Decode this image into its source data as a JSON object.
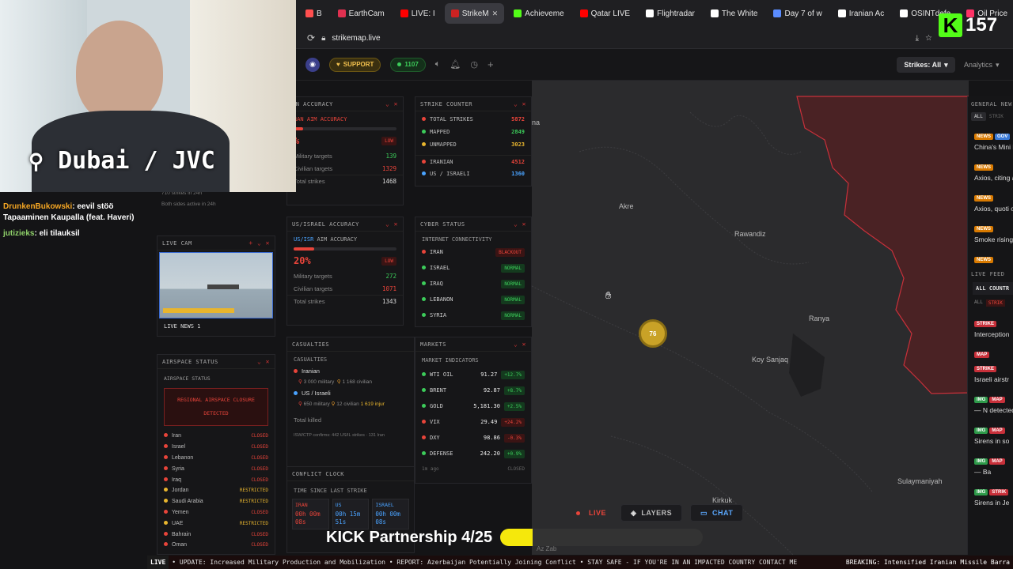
{
  "browser": {
    "tabs": [
      {
        "label": "B",
        "color": "#ff4f4f"
      },
      {
        "label": "EarthCam",
        "color": "#e03050"
      },
      {
        "label": "LIVE: I",
        "color": "#ff0000"
      },
      {
        "label": "StrikeM",
        "color": "#cc2222",
        "active": true
      },
      {
        "label": "Achieveme",
        "color": "#53fc18"
      },
      {
        "label": "Qatar LIVE",
        "color": "#ff0000"
      },
      {
        "label": "Flightradar",
        "color": "#ffffff"
      },
      {
        "label": "The White",
        "color": "#ffffff"
      },
      {
        "label": "Day 7 of w",
        "color": "#5a8cff"
      },
      {
        "label": "Iranian Ac",
        "color": "#ffffff"
      },
      {
        "label": "OSINTdefe",
        "color": "#ffffff"
      },
      {
        "label": "Oil Price",
        "color": "#ff3366"
      }
    ],
    "url": "strikemap.live"
  },
  "stream": {
    "location_overlay": "Dubai / JVC",
    "viewer_count": "157",
    "partnership_text": "KICK Partnership 4/25",
    "partnership_progress": 0.16,
    "chat": [
      {
        "user": "DrunkenBukowski",
        "user_color": "#f5a623",
        "message": "eevil stöö Tapaaminen Kaupalla (feat. Haveri)"
      },
      {
        "user": "jutizieks",
        "user_color": "#8fd16a",
        "message": "eli tilauksil"
      }
    ]
  },
  "toolbar": {
    "support_label": "SUPPORT",
    "online_count": "1107",
    "strikes_filter": "Strikes: All",
    "analytics_label": "Analytics"
  },
  "left_column": {
    "stats_lines": [
      "710 strikes in 24h",
      "Both sides active in 24h"
    ],
    "live_cam": {
      "title": "LIVE CAM",
      "caption": "LIVE NEWS 1"
    },
    "airspace": {
      "title": "AIRSPACE STATUS",
      "subtitle": "AIRSPACE STATUS",
      "alert": "REGIONAL AIRSPACE CLOSURE DETECTED",
      "rows": [
        {
          "name": "Iran",
          "status": "CLOSED",
          "color": "#e8443a"
        },
        {
          "name": "Israel",
          "status": "CLOSED",
          "color": "#e8443a"
        },
        {
          "name": "Lebanon",
          "status": "CLOSED",
          "color": "#e8443a"
        },
        {
          "name": "Syria",
          "status": "CLOSED",
          "color": "#e8443a"
        },
        {
          "name": "Iraq",
          "status": "CLOSED",
          "color": "#e8443a"
        },
        {
          "name": "Jordan",
          "status": "RESTRICTED",
          "color": "#e8b52e"
        },
        {
          "name": "Saudi Arabia",
          "status": "RESTRICTED",
          "color": "#e8b52e"
        },
        {
          "name": "Yemen",
          "status": "CLOSED",
          "color": "#e8443a"
        },
        {
          "name": "UAE",
          "status": "RESTRICTED",
          "color": "#e8b52e"
        },
        {
          "name": "Bahrain",
          "status": "CLOSED",
          "color": "#e8443a"
        },
        {
          "name": "Oman",
          "status": "CLOSED",
          "color": "#e8443a"
        }
      ]
    }
  },
  "iran_accuracy": {
    "title": "AN ACCURACY",
    "label": "RAN AIM ACCURACY",
    "percent": "%",
    "rating": "LOW",
    "military_label": "Military targets",
    "military": "139",
    "civilian_label": "Civilian targets",
    "civilian": "1329",
    "total_label": "Total strikes",
    "total": "1468"
  },
  "us_accuracy": {
    "title": "US/ISRAEL ACCURACY",
    "label_prefix": "US/ISR",
    "label": "AIM ACCURACY",
    "percent": "20%",
    "rating": "LOW",
    "military_label": "Military targets",
    "military": "272",
    "civilian_label": "Civilian targets",
    "civilian": "1071",
    "total_label": "Total strikes",
    "total": "1343"
  },
  "strike_counter": {
    "title": "STRIKE COUNTER",
    "rows": [
      {
        "label": "TOTAL STRIKES",
        "value": "5872",
        "color": "#e8443a"
      },
      {
        "label": "MAPPED",
        "value": "2849",
        "color": "#3ccc5a"
      },
      {
        "label": "UNMAPPED",
        "value": "3023",
        "color": "#e8b52e"
      },
      {
        "label": "IRANIAN",
        "value": "4512",
        "color": "#e8443a"
      },
      {
        "label": "US / ISRAELI",
        "value": "1360",
        "color": "#4aa3ff"
      }
    ]
  },
  "cyber": {
    "title": "CYBER STATUS",
    "subtitle": "INTERNET CONNECTIVITY",
    "rows": [
      {
        "name": "IRAN",
        "status": "BLACKOUT",
        "bad": true
      },
      {
        "name": "ISRAEL",
        "status": "NORMAL"
      },
      {
        "name": "IRAQ",
        "status": "NORMAL"
      },
      {
        "name": "LEBANON",
        "status": "NORMAL"
      },
      {
        "name": "SYRIA",
        "status": "NORMAL"
      }
    ]
  },
  "casualties": {
    "title": "CASUALTIES",
    "subtitle": "CASUALTIES",
    "iranian_label": "Iranian",
    "iranian_military": "3 000 military",
    "iranian_civilian": "1 168 civilian",
    "us_label": "US / Israeli",
    "us_military": "650 military",
    "us_civilian": "12 civilian",
    "us_injured": "1 619 injur",
    "total_label": "Total killed",
    "confirms": "ISW/CTP confirms: 442 US/IL strikes · 131 Iran"
  },
  "conflict_clock": {
    "title": "CONFLICT CLOCK",
    "subtitle": "TIME SINCE LAST STRIKE",
    "cells": [
      {
        "label": "IRAN",
        "value": "00h 00m 08s",
        "color": "#e8443a"
      },
      {
        "label": "US",
        "value": "00h 15m 51s",
        "color": "#4aa3ff"
      },
      {
        "label": "ISRAEL",
        "value": "00h 00m 08s",
        "color": "#4aa3ff"
      }
    ]
  },
  "markets": {
    "title": "MARKETS",
    "subtitle": "MARKET INDICATORS",
    "rows": [
      {
        "name": "WTI OIL",
        "value": "91.27",
        "change": "+12.7%",
        "up": true
      },
      {
        "name": "BRENT",
        "value": "92.87",
        "change": "+8.7%",
        "up": true
      },
      {
        "name": "GOLD",
        "value": "5,181.30",
        "change": "+2.5%",
        "up": true
      },
      {
        "name": "VIX",
        "value": "29.49",
        "change": "+24.2%",
        "up": false
      },
      {
        "name": "DXY",
        "value": "98.86",
        "change": "-0.3%",
        "up": false
      },
      {
        "name": "DEFENSE",
        "value": "242.20",
        "change": "+0.9%",
        "up": true
      }
    ],
    "updated": "1m ago",
    "status": "CLOSED"
  },
  "map": {
    "cities": [
      "na",
      "Akre",
      "Rawandiz",
      "Ranya",
      "Koy Sanjaq",
      "Sulaymaniyah",
      "Kirkuk",
      "Az Zab"
    ],
    "cluster_count": "76",
    "controls": {
      "live": "LIVE",
      "layers": "LAYERS",
      "chat": "CHAT"
    }
  },
  "news": {
    "title": "GENERAL NEW",
    "filter_all": "ALL",
    "filter_strike": "STRIK",
    "items": [
      {
        "tags": [
          "NEWS",
          "GOV"
        ],
        "text": "China's Mini keep improv"
      },
      {
        "tags": [
          "NEWS"
        ],
        "text": "Axios, citing armed grou"
      },
      {
        "tags": [
          "NEWS"
        ],
        "text": "Axios, quoti observed the"
      },
      {
        "tags": [
          "NEWS"
        ],
        "text": "Smoke rising reports of Ira"
      },
      {
        "tags": [
          "NEWS"
        ],
        "text": ""
      }
    ],
    "live_feed_title": "LIVE FEED",
    "country_filter": "ALL COUNTR",
    "feed_filter_all": "ALL",
    "feed_filter_strike": "STRIK",
    "feed": [
      {
        "tags": [
          "STRIKE"
        ],
        "text": "Interception"
      },
      {
        "tags": [
          "MAP",
          "STRIKE"
        ],
        "text": "Israeli airstr"
      },
      {
        "tags": [
          "IMG",
          "MAP"
        ],
        "text": "— N detected to"
      },
      {
        "tags": [
          "IMG",
          "MAP"
        ],
        "text": "Sirens in so"
      },
      {
        "tags": [
          "IMG",
          "MAP"
        ],
        "text": "— Ba"
      },
      {
        "tags": [
          "IMG",
          "STRIK"
        ],
        "text": "Sirens in Je"
      }
    ]
  },
  "ticker": {
    "live_label": "LIVE",
    "text": "• UPDATE: Increased Military Production and Mobilization • REPORT: Azerbaijan Potentially Joining Conflict • STAY SAFE - IF YOU'RE IN AN IMPACTED COUNTRY CONTACT ME",
    "breaking": "BREAKING: Intensified Iranian Missile Barra"
  }
}
